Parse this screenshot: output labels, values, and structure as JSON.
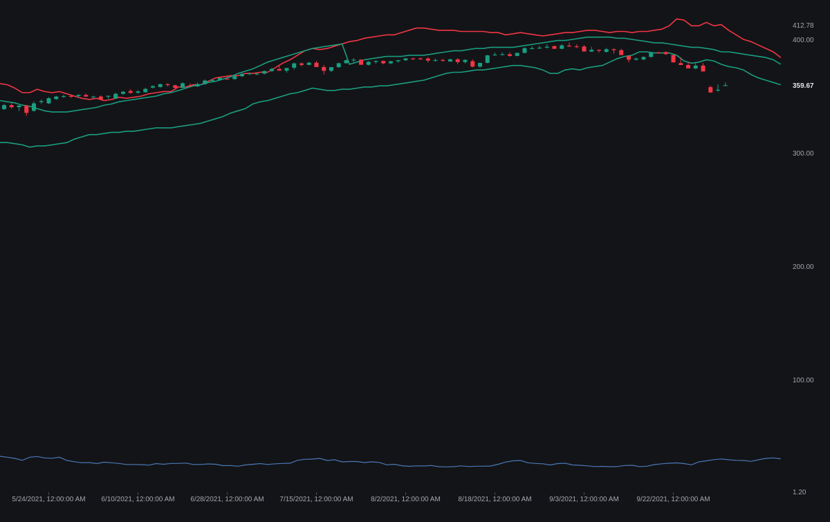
{
  "chart_data": {
    "type": "candlestick",
    "colors": {
      "background": "#131417",
      "up": "#1a9e81",
      "down": "#f23645",
      "upper_band": "#f23645",
      "lower_band": "#1a9e81",
      "indicator": "#4a78b8",
      "axis_text": "#a3a6af"
    },
    "price_axis": {
      "ticks": [
        "412.78",
        "400.00",
        "300.00",
        "200.00",
        "100.00",
        "1.20"
      ],
      "tick_values": [
        412.78,
        400,
        300,
        200,
        100,
        1.2
      ],
      "last_price_label": "359.67",
      "last_price": 359.67
    },
    "time_axis": {
      "labels": [
        "5/24/2021, 12:00:00 AM",
        "6/10/2021, 12:00:00 AM",
        "6/28/2021, 12:00:00 AM",
        "7/15/2021, 12:00:00 AM",
        "8/2/2021, 12:00:00 AM",
        "8/18/2021, 12:00:00 AM",
        "9/3/2021, 12:00:00 AM",
        "9/22/2021, 12:00:00 AM"
      ],
      "label_bar_index": [
        6,
        18,
        30,
        42,
        54,
        66,
        78,
        90
      ]
    },
    "candles": [
      [
        338.5,
        343.2,
        337.8,
        342.0
      ],
      [
        342.0,
        344.5,
        338.9,
        340.2
      ],
      [
        340.2,
        342.0,
        336.8,
        341.6
      ],
      [
        341.6,
        342.3,
        332.6,
        335.2
      ],
      [
        337.0,
        345.3,
        336.2,
        343.6
      ],
      [
        344.7,
        347.0,
        343.0,
        345.6
      ],
      [
        343.6,
        349.1,
        343.0,
        348.1
      ],
      [
        347.4,
        350.2,
        346.5,
        349.6
      ],
      [
        349.6,
        351.2,
        348.4,
        350.0
      ],
      [
        350.1,
        350.6,
        348.4,
        349.8
      ],
      [
        350.0,
        351.5,
        348.9,
        351.0
      ],
      [
        351.0,
        352.3,
        349.1,
        349.6
      ],
      [
        349.0,
        350.2,
        347.2,
        349.6
      ],
      [
        349.6,
        350.6,
        346.6,
        347.0
      ],
      [
        350.2,
        350.6,
        347.5,
        350.2
      ],
      [
        347.8,
        352.9,
        347.5,
        352.0
      ],
      [
        352.0,
        354.5,
        351.2,
        353.8
      ],
      [
        354.5,
        356.0,
        352.2,
        352.8
      ],
      [
        352.9,
        355.1,
        352.3,
        354.1
      ],
      [
        353.4,
        357.3,
        353.0,
        356.3
      ],
      [
        357.5,
        359.5,
        356.7,
        358.8
      ],
      [
        358.0,
        360.9,
        357.5,
        360.5
      ],
      [
        360.5,
        361.2,
        358.4,
        359.7
      ],
      [
        359.5,
        360.0,
        355.7,
        357.3
      ],
      [
        357.3,
        362.2,
        357.0,
        361.3
      ],
      [
        359.2,
        361.1,
        358.4,
        358.8
      ],
      [
        358.5,
        361.9,
        358.1,
        360.6
      ],
      [
        360.6,
        364.6,
        359.9,
        363.7
      ],
      [
        364.0,
        365.0,
        362.6,
        364.1
      ],
      [
        364.1,
        366.2,
        364.0,
        366.0
      ],
      [
        365.3,
        367.7,
        364.6,
        365.0
      ],
      [
        365.0,
        368.3,
        364.5,
        367.5
      ],
      [
        367.5,
        370.5,
        366.8,
        369.6
      ],
      [
        369.6,
        370.9,
        368.5,
        370.0
      ],
      [
        369.6,
        370.3,
        368.5,
        369.8
      ],
      [
        369.8,
        372.6,
        369.1,
        372.1
      ],
      [
        372.1,
        374.8,
        371.3,
        374.0
      ],
      [
        374.0,
        377.6,
        374.6,
        372.4
      ],
      [
        372.4,
        375.1,
        370.6,
        374.7
      ],
      [
        375.0,
        379.7,
        373.3,
        378.8
      ],
      [
        378.8,
        379.7,
        376.2,
        377.5
      ],
      [
        377.5,
        380.2,
        377.2,
        379.4
      ],
      [
        379.4,
        381.0,
        375.9,
        375.6
      ],
      [
        375.6,
        377.5,
        369.1,
        372.3
      ],
      [
        372.3,
        375.5,
        371.1,
        375.5
      ],
      [
        375.5,
        379.4,
        375.0,
        379.0
      ],
      [
        379.0,
        382.5,
        378.6,
        381.6
      ],
      [
        381.6,
        383.4,
        379.9,
        382.1
      ],
      [
        382.1,
        382.6,
        378.8,
        377.6
      ],
      [
        377.6,
        381.0,
        376.8,
        380.2
      ],
      [
        380.2,
        381.5,
        378.6,
        381.0
      ],
      [
        381.0,
        381.3,
        378.0,
        378.9
      ],
      [
        378.9,
        381.1,
        378.1,
        380.7
      ],
      [
        380.7,
        382.0,
        379.4,
        381.6
      ],
      [
        381.6,
        383.6,
        381.1,
        383.2
      ],
      [
        383.2,
        383.8,
        381.8,
        382.6
      ],
      [
        383.2,
        383.9,
        382.0,
        383.1
      ],
      [
        383.1,
        384.5,
        379.6,
        381.3
      ],
      [
        381.3,
        383.0,
        380.3,
        381.8
      ],
      [
        381.8,
        382.9,
        380.2,
        381.4
      ],
      [
        380.5,
        383.0,
        380.2,
        382.4
      ],
      [
        382.4,
        383.5,
        378.2,
        380.0
      ],
      [
        380.0,
        382.5,
        378.8,
        381.9
      ],
      [
        380.8,
        382.3,
        375.2,
        376.0
      ],
      [
        376.0,
        378.0,
        375.0,
        379.3
      ],
      [
        379.3,
        386.3,
        378.9,
        385.9
      ],
      [
        386.1,
        388.5,
        385.6,
        386.6
      ],
      [
        386.6,
        388.5,
        386.0,
        386.9
      ],
      [
        386.9,
        388.6,
        384.7,
        385.4
      ],
      [
        385.4,
        388.2,
        385.1,
        388.1
      ],
      [
        388.1,
        392.8,
        387.7,
        392.3
      ],
      [
        392.1,
        394.0,
        391.3,
        392.2
      ],
      [
        392.2,
        394.4,
        391.6,
        392.7
      ],
      [
        392.7,
        395.7,
        391.9,
        393.5
      ],
      [
        394.1,
        394.4,
        391.6,
        391.7
      ],
      [
        391.7,
        395.9,
        391.4,
        394.7
      ],
      [
        394.5,
        397.2,
        393.2,
        393.9
      ],
      [
        393.9,
        395.6,
        392.3,
        393.7
      ],
      [
        393.7,
        395.1,
        390.2,
        389.3
      ],
      [
        389.3,
        393.5,
        388.7,
        390.8
      ],
      [
        390.8,
        391.1,
        388.3,
        390.3
      ],
      [
        389.0,
        392.5,
        388.3,
        391.3
      ],
      [
        391.3,
        392.1,
        387.4,
        390.5
      ],
      [
        390.5,
        391.7,
        386.0,
        386.2
      ],
      [
        385.4,
        385.8,
        379.7,
        382.1
      ],
      [
        382.1,
        383.9,
        381.4,
        383.1
      ],
      [
        382.3,
        385.0,
        381.7,
        384.5
      ],
      [
        384.5,
        389.0,
        384.2,
        388.4
      ],
      [
        388.4,
        389.2,
        388.1,
        388.1
      ],
      [
        388.8,
        389.5,
        386.3,
        387.0
      ],
      [
        386.2,
        386.8,
        380.8,
        379.7
      ],
      [
        379.1,
        384.2,
        378.5,
        377.4
      ],
      [
        377.4,
        379.9,
        376.3,
        374.4
      ],
      [
        374.4,
        378.9,
        373.7,
        376.9
      ],
      [
        376.9,
        379.1,
        371.7,
        371.7
      ],
      [
        357.9,
        359.2,
        352.9,
        353.2
      ],
      [
        355.4,
        360.3,
        353.8,
        355.6
      ],
      [
        359.6,
        362.0,
        358.8,
        359.6
      ]
    ],
    "upper_band": [
      361,
      360,
      357,
      353,
      353,
      356,
      354,
      353,
      354,
      352,
      350,
      348,
      347,
      348,
      346,
      347,
      349,
      348,
      349,
      350,
      352,
      353,
      354,
      354,
      358,
      358,
      360,
      360,
      363,
      366,
      367,
      368,
      368,
      370,
      370,
      371,
      371,
      375,
      379,
      382,
      386,
      390,
      392,
      391,
      392,
      394,
      396,
      398,
      399,
      401,
      402,
      403,
      404,
      404,
      406,
      408,
      410,
      410,
      409,
      408,
      408,
      408,
      407,
      407,
      407,
      407,
      406,
      406,
      404,
      405,
      406,
      405,
      404,
      403,
      404,
      405,
      406,
      406,
      407,
      408,
      408,
      407,
      406,
      407,
      407,
      406,
      407,
      407,
      408,
      409,
      412,
      418,
      417,
      412,
      412,
      415,
      412,
      413,
      408,
      404,
      400,
      398,
      395,
      392,
      389,
      384
    ],
    "middle_band": [
      346,
      345,
      344,
      342,
      341,
      339,
      337,
      336,
      336,
      336,
      337,
      338,
      339,
      340,
      342,
      343,
      345,
      346,
      347,
      348,
      349,
      350,
      352,
      353,
      355,
      357,
      359,
      360,
      362,
      363,
      365,
      367,
      370,
      372,
      374,
      377,
      380,
      382,
      384,
      386,
      388,
      390,
      392,
      393,
      394,
      395,
      396,
      378,
      380,
      382,
      383,
      384,
      385,
      385,
      385,
      386,
      386,
      386,
      387,
      388,
      389,
      390,
      390,
      391,
      392,
      392,
      393,
      393,
      393,
      393,
      394,
      395,
      396,
      397,
      398,
      399,
      399,
      400,
      401,
      402,
      402,
      402,
      402,
      401,
      401,
      400,
      399,
      398,
      397,
      397,
      396,
      395,
      394,
      393,
      393,
      392,
      391,
      389,
      389,
      388,
      387,
      386,
      385,
      384,
      382,
      378
    ],
    "lower_band": [
      309,
      309,
      308,
      307,
      305,
      306,
      306,
      307,
      308,
      309,
      312,
      314,
      316,
      316,
      317,
      318,
      318,
      319,
      319,
      320,
      321,
      322,
      322,
      322,
      323,
      324,
      325,
      326,
      328,
      330,
      332,
      335,
      337,
      339,
      343,
      345,
      346,
      348,
      350,
      352,
      353,
      355,
      357,
      356,
      355,
      355,
      356,
      356,
      357,
      358,
      358,
      359,
      359,
      360,
      361,
      362,
      363,
      364,
      366,
      368,
      370,
      371,
      371,
      372,
      373,
      373,
      374,
      375,
      376,
      377,
      377,
      376,
      375,
      373,
      370,
      370,
      373,
      374,
      373,
      375,
      376,
      377,
      380,
      383,
      385,
      386,
      389,
      389,
      388,
      388,
      388,
      386,
      381,
      379,
      380,
      382,
      381,
      378,
      376,
      375,
      373,
      369,
      366,
      364,
      362,
      360
    ],
    "indicator": {
      "values": [
        22.0,
        21.5,
        20.8,
        19.7,
        21.5,
        21.9,
        21.1,
        20.9,
        21.5,
        19.6,
        18.9,
        18.3,
        18.4,
        17.8,
        18.6,
        18.3,
        17.9,
        17.3,
        17.3,
        17.2,
        16.9,
        17.8,
        17.4,
        17.9,
        17.9,
        18.1,
        17.3,
        17.3,
        17.6,
        17.4,
        16.6,
        16.7,
        16.3,
        17.0,
        17.4,
        17.8,
        17.3,
        17.7,
        17.9,
        18.0,
        19.7,
        20.3,
        20.4,
        20.8,
        19.6,
        20.0,
        18.8,
        19.0,
        19.0,
        18.4,
        18.8,
        18.5,
        17.1,
        17.4,
        16.6,
        16.2,
        16.5,
        16.4,
        16.7,
        16.0,
        15.9,
        16.0,
        16.5,
        16.1,
        16.3,
        16.3,
        16.4,
        17.4,
        18.7,
        19.4,
        19.6,
        18.3,
        17.9,
        17.7,
        17.0,
        17.8,
        18.0,
        17.0,
        16.8,
        16.5,
        16.1,
        16.2,
        16.0,
        16.1,
        16.7,
        16.8,
        16.1,
        16.3,
        17.2,
        17.7,
        18.0,
        18.2,
        17.8,
        17.1,
        18.8,
        19.4,
        20.1,
        20.5,
        20.0,
        19.7,
        19.6,
        19.1,
        20.0,
        20.8,
        21.1,
        20.6
      ],
      "scale": [
        12,
        30
      ]
    }
  }
}
